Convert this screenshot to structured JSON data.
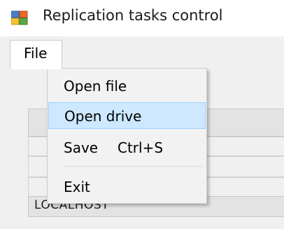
{
  "window": {
    "title": "Replication tasks control"
  },
  "menubar": {
    "file_label": "File"
  },
  "file_menu": {
    "items": [
      {
        "label": "Open file",
        "shortcut": ""
      },
      {
        "label": "Open drive",
        "shortcut": "",
        "highlighted": true
      },
      {
        "label": "Save",
        "shortcut": "Ctrl+S"
      },
      {
        "label": "Exit",
        "shortcut": ""
      }
    ]
  },
  "form": {
    "server_value": "LOCALHOST"
  },
  "colors": {
    "highlight_bg": "#cde8ff",
    "highlight_border": "#99d1ff",
    "menu_bg": "#f2f2f2",
    "client_bg": "#f0f0f0"
  },
  "icons": {
    "app_icon": "app-window-icon"
  }
}
